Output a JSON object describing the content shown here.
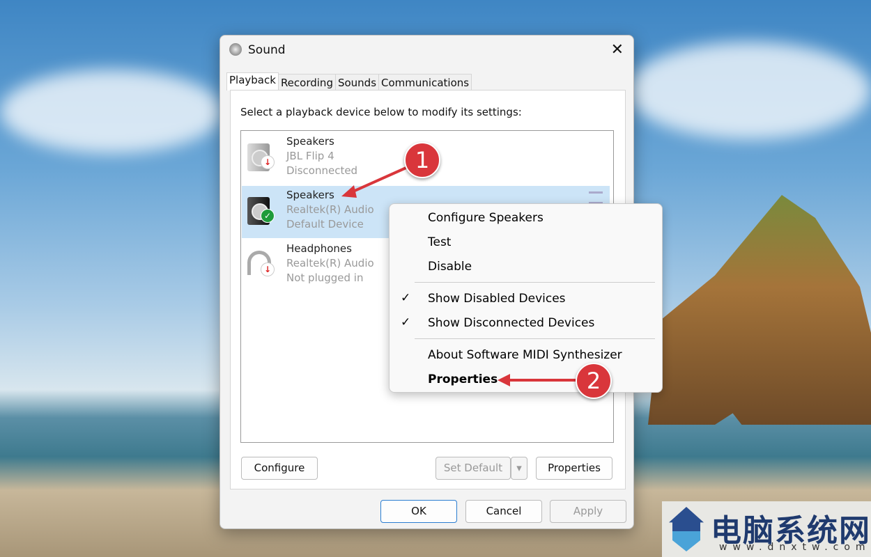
{
  "dialog": {
    "title": "Sound",
    "close": "✕",
    "tabs": [
      "Playback",
      "Recording",
      "Sounds",
      "Communications"
    ],
    "instruction": "Select a playback device below to modify its settings:",
    "devices": [
      {
        "name": "Speakers",
        "sub": "JBL Flip 4",
        "status": "Disconnected",
        "badge": "↓"
      },
      {
        "name": "Speakers",
        "sub": "Realtek(R) Audio",
        "status": "Default Device",
        "badge": "✓"
      },
      {
        "name": "Headphones",
        "sub": "Realtek(R) Audio",
        "status": "Not plugged in",
        "badge": "↓"
      }
    ],
    "buttons": {
      "configure": "Configure",
      "set_default": "Set Default",
      "dropdown": "▾",
      "properties": "Properties",
      "ok": "OK",
      "cancel": "Cancel",
      "apply": "Apply"
    }
  },
  "context_menu": {
    "items": [
      "Configure Speakers",
      "Test",
      "Disable",
      "Show Disabled Devices",
      "Show Disconnected Devices",
      "About Software MIDI Synthesizer",
      "Properties"
    ],
    "check": "✓"
  },
  "callouts": [
    "1",
    "2"
  ],
  "watermark": {
    "cn": "电脑系统网",
    "url": "www.dnxtw.com"
  }
}
